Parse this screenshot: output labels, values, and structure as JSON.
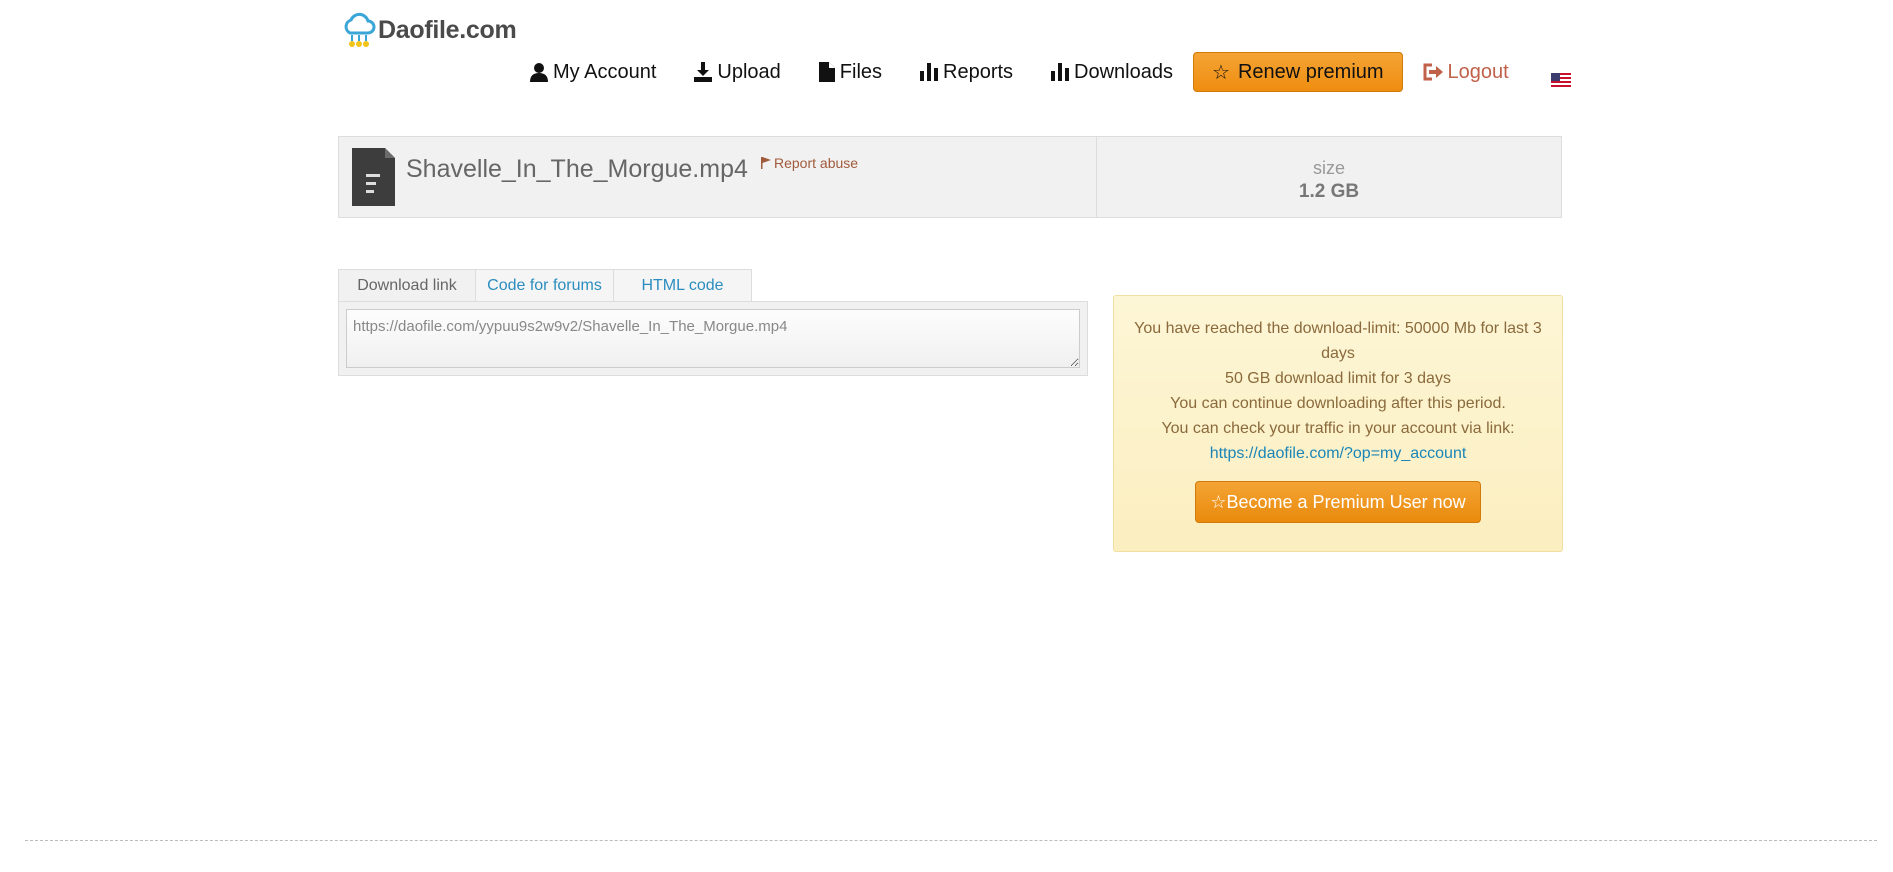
{
  "logo": {
    "text": "Daofile.com",
    "icon": "cloud-icon"
  },
  "nav": {
    "my_account": "My Account",
    "upload": "Upload",
    "files": "Files",
    "reports": "Reports",
    "downloads": "Downloads",
    "renew_premium": "Renew premium",
    "logout": "Logout",
    "language_flag": "us-flag-icon"
  },
  "file": {
    "name": "Shavelle_In_The_Morgue.mp4",
    "report_abuse": "Report abuse",
    "size_label": "size",
    "size_value": "1.2 GB"
  },
  "tabs": [
    "Download link",
    "Code for forums",
    "HTML code"
  ],
  "link_box": {
    "value": "https://daofile.com/yypuu9s2w9v2/Shavelle_In_The_Morgue.mp4"
  },
  "limit_notice": {
    "line1": "You have reached the download-limit: 50000 Mb for last 3 days",
    "line2": "50 GB download limit for 3 days",
    "line3": "You can continue downloading after this period.",
    "line4": "You can check your traffic in your account via link:",
    "account_link": "https://daofile.com/?op=my_account",
    "premium_button": "Become a Premium User now"
  },
  "colors": {
    "accent_orange": "#ef8d10",
    "link_blue": "#1a86b8",
    "logout_red": "#c0614a",
    "notice_bg": "#fbeec0"
  }
}
